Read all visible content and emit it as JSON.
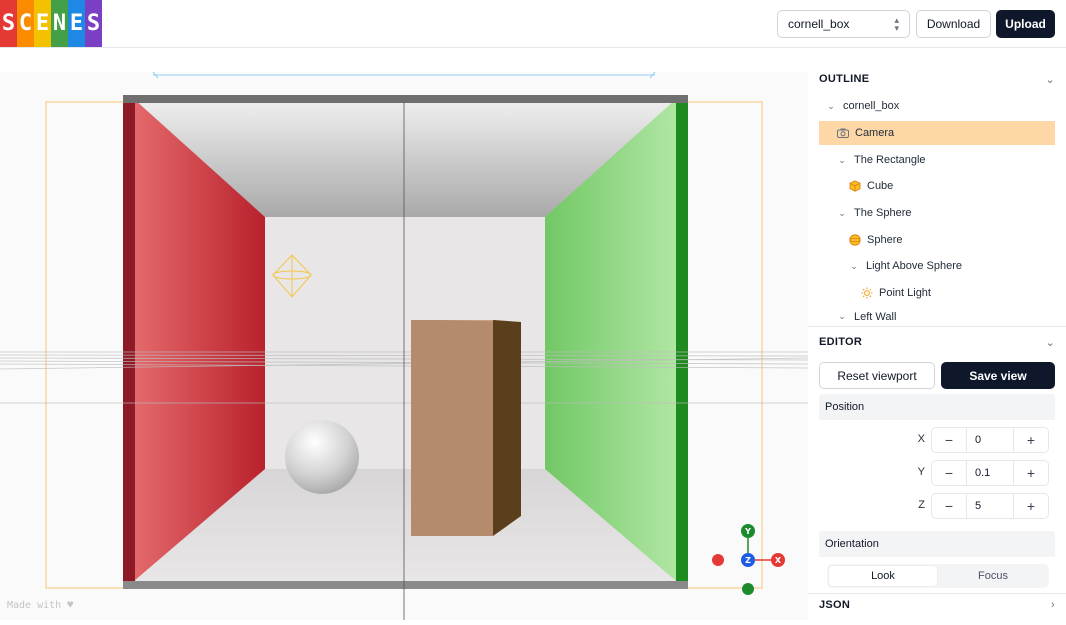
{
  "header": {
    "logo_letters": [
      "S",
      "C",
      "E",
      "N",
      "E",
      "S"
    ],
    "logo_colors": [
      "#e53935",
      "#fb8c00",
      "#fdd835",
      "#43a047",
      "#1e88e5",
      "#8e24aa"
    ],
    "scene_select": "cornell_box",
    "download_label": "Download",
    "upload_label": "Upload"
  },
  "viewport": {
    "made_with": "Made with ♥",
    "gizmo": {
      "y": "Y",
      "z": "Z",
      "x": "X"
    },
    "colors": {
      "left_wall": "#c8252e",
      "right_wall": "#7fd26f",
      "box": "#b48b6c",
      "selection": "#f5c64a"
    }
  },
  "outline": {
    "title": "OUTLINE",
    "items": [
      {
        "label": "cornell_box",
        "indent": 0,
        "arrow": "⌄",
        "icon": "none"
      },
      {
        "label": "Camera",
        "indent": 0,
        "arrow": "",
        "icon": "camera-icon",
        "selected": true
      },
      {
        "label": "The Rectangle",
        "indent": 1,
        "arrow": "⌄",
        "icon": "none"
      },
      {
        "label": "Cube",
        "indent": 1,
        "arrow": "",
        "icon": "cube-icon"
      },
      {
        "label": "The Sphere",
        "indent": 1,
        "arrow": "⌄",
        "icon": "none"
      },
      {
        "label": "Sphere",
        "indent": 1,
        "arrow": "",
        "icon": "sphere-icon"
      },
      {
        "label": "Light Above Sphere",
        "indent": 2,
        "arrow": "⌄",
        "icon": "none"
      },
      {
        "label": "Point Light",
        "indent": 2,
        "arrow": "",
        "icon": "sun-icon"
      },
      {
        "label": "Left Wall",
        "indent": 1,
        "arrow": "⌄",
        "icon": "none"
      }
    ]
  },
  "editor": {
    "title": "EDITOR",
    "reset_label": "Reset viewport",
    "save_label": "Save view",
    "position": {
      "title": "Position",
      "x_label": "X",
      "x": "0",
      "y_label": "Y",
      "y": "0.1",
      "z_label": "Z",
      "z": "5"
    },
    "orientation": {
      "title": "Orientation",
      "look": "Look",
      "focus": "Focus",
      "active": "Look"
    }
  },
  "json_section": {
    "title": "JSON"
  }
}
